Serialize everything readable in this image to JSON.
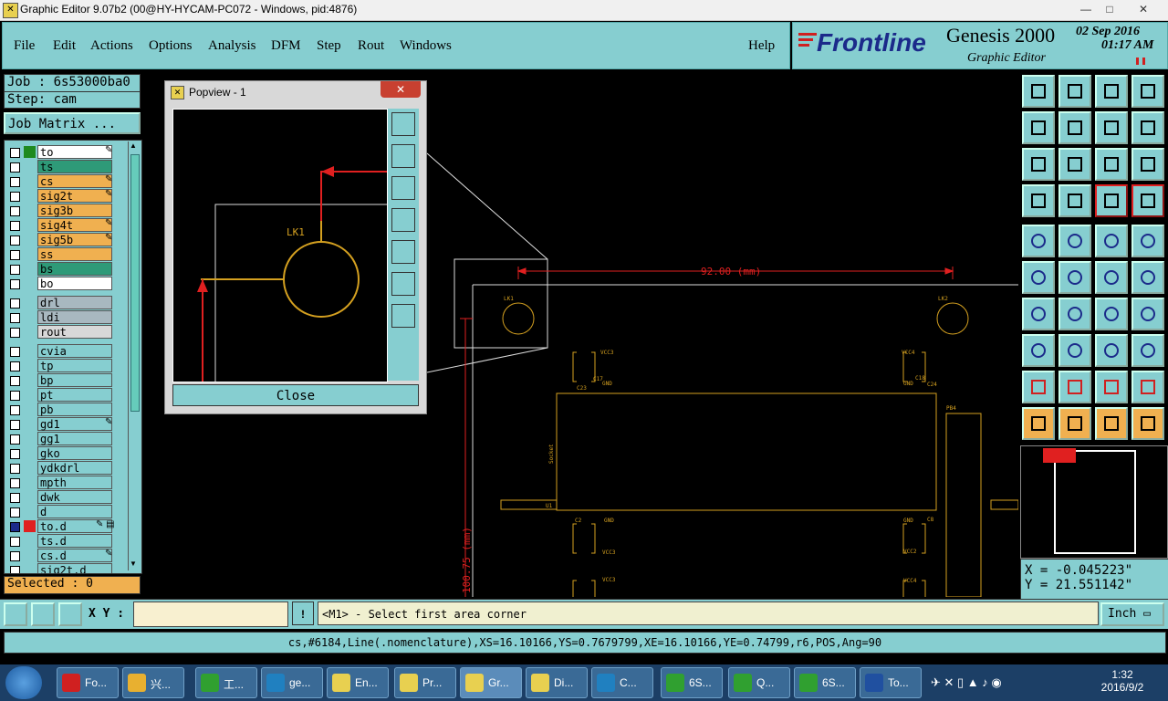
{
  "window": {
    "title": "Graphic Editor 9.07b2 (00@HY-HYCAM-PC072 - Windows, pid:4876)",
    "min": "—",
    "max": "□",
    "close": "✕"
  },
  "menu": {
    "items": [
      "File",
      "Edit",
      "Actions",
      "Options",
      "Analysis",
      "DFM",
      "Step",
      "Rout",
      "Windows"
    ],
    "help": "Help"
  },
  "brand": {
    "logo": "Frontline",
    "product": "Genesis 2000",
    "subtitle": "Graphic Editor",
    "date": "02 Sep 2016",
    "time": "01:17 AM"
  },
  "job": {
    "job_label": "Job : 6s53000ba0",
    "step_label": "Step: cam",
    "matrix_button": "Job Matrix ..."
  },
  "layers": [
    {
      "name": "to",
      "bg": "#ffffff",
      "swatch": "#1f8a1f",
      "mark": "✎"
    },
    {
      "name": "ts",
      "bg": "#2e9a78",
      "swatch": "",
      "mark": ""
    },
    {
      "name": "cs",
      "bg": "#f0b050",
      "swatch": "",
      "mark": "✎"
    },
    {
      "name": "sig2t",
      "bg": "#f0b050",
      "swatch": "",
      "mark": "✎"
    },
    {
      "name": "sig3b",
      "bg": "#f0b050",
      "swatch": "",
      "mark": ""
    },
    {
      "name": "sig4t",
      "bg": "#f0b050",
      "swatch": "",
      "mark": "✎"
    },
    {
      "name": "sig5b",
      "bg": "#f0b050",
      "swatch": "",
      "mark": "✎"
    },
    {
      "name": "ss",
      "bg": "#f0b050",
      "swatch": "",
      "mark": ""
    },
    {
      "name": "bs",
      "bg": "#2e9a78",
      "swatch": "",
      "mark": ""
    },
    {
      "name": "bo",
      "bg": "#ffffff",
      "swatch": "",
      "mark": ""
    },
    {
      "name": "drl",
      "bg": "#a8b8c0",
      "swatch": "",
      "mark": ""
    },
    {
      "name": "ldi",
      "bg": "#a8b8c0",
      "swatch": "",
      "mark": ""
    },
    {
      "name": "rout",
      "bg": "#d8d8d8",
      "swatch": "",
      "mark": ""
    },
    {
      "name": "cvia",
      "bg": "#86ced0",
      "swatch": "",
      "mark": ""
    },
    {
      "name": "tp",
      "bg": "#86ced0",
      "swatch": "",
      "mark": ""
    },
    {
      "name": "bp",
      "bg": "#86ced0",
      "swatch": "",
      "mark": ""
    },
    {
      "name": "pt",
      "bg": "#86ced0",
      "swatch": "",
      "mark": ""
    },
    {
      "name": "pb",
      "bg": "#86ced0",
      "swatch": "",
      "mark": ""
    },
    {
      "name": "gd1",
      "bg": "#86ced0",
      "swatch": "",
      "mark": "✎"
    },
    {
      "name": "gg1",
      "bg": "#86ced0",
      "swatch": "",
      "mark": ""
    },
    {
      "name": "gko",
      "bg": "#86ced0",
      "swatch": "",
      "mark": ""
    },
    {
      "name": "ydkdrl",
      "bg": "#86ced0",
      "swatch": "",
      "mark": ""
    },
    {
      "name": "mpth",
      "bg": "#86ced0",
      "swatch": "",
      "mark": ""
    },
    {
      "name": "dwk",
      "bg": "#86ced0",
      "swatch": "",
      "mark": ""
    },
    {
      "name": "d",
      "bg": "#86ced0",
      "swatch": "",
      "mark": ""
    },
    {
      "name": "to.d",
      "bg": "#86ced0",
      "swatch": "#e02020",
      "mark": "✎ ▤"
    },
    {
      "name": "ts.d",
      "bg": "#86ced0",
      "swatch": "",
      "mark": ""
    },
    {
      "name": "cs.d",
      "bg": "#86ced0",
      "swatch": "",
      "mark": "✎"
    },
    {
      "name": "sig2t.d",
      "bg": "#86ced0",
      "swatch": "",
      "mark": ""
    }
  ],
  "selected_label": "Selected : 0",
  "popview": {
    "title": "Popview - 1",
    "close": "Close",
    "part_label": "LK1"
  },
  "canvas": {
    "dimension_h": "92.00 (mm)",
    "dimension_v": "100.75 (mm)",
    "labels": [
      "LK1",
      "LK2",
      "VCC3",
      "VCC4",
      "GND",
      "GND",
      "C23",
      "C24",
      "U1",
      "Socket",
      "C2",
      "C8",
      "GND",
      "GND",
      "VCC3",
      "VCC2",
      "VCC3",
      "VCC4",
      "PB4",
      "C17",
      "C18"
    ]
  },
  "coords": {
    "x": "X = -0.045223\"",
    "y": "Y = 21.551142\""
  },
  "command": {
    "xy_label": "X Y :",
    "bang": "!",
    "prompt": "<M1> - Select first area corner",
    "unit": "Inch"
  },
  "status": "cs,#6184,Line(.nomenclature),XS=16.10166,YS=0.7679799,XE=16.10166,YE=0.74799,r6,POS,Ang=90",
  "taskbar": {
    "items": [
      "Fo...",
      "兴...",
      "工...",
      "ge...",
      "En...",
      "Pr...",
      "Gr...",
      "Di...",
      "C...",
      "6S...",
      "Q...",
      "6S...",
      "To..."
    ],
    "time": "1:32",
    "date": "2016/9/2"
  },
  "colors": {
    "panel": "#86ced0",
    "trace": "#d4a020",
    "dim": "#e02020"
  }
}
